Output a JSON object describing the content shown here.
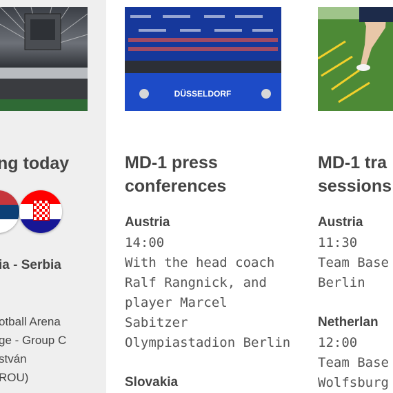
{
  "left_card": {
    "title": "ng today",
    "fixture": "ia - Serbia",
    "venue_lines": [
      "otball Arena",
      "ge - Group C",
      "stván",
      "ROU)"
    ]
  },
  "mid_card": {
    "image_text": "DÜSSELDORF",
    "title_lines": [
      "MD-1 press",
      "conferences"
    ],
    "entries": [
      {
        "country": "Austria",
        "time": "14:00",
        "details": [
          "With the head coach",
          "Ralf Rangnick, and",
          "player Marcel",
          "Sabitzer",
          "Olympiastadion Berlin"
        ]
      },
      {
        "country": "Slovakia"
      }
    ]
  },
  "right_card": {
    "title_lines": [
      "MD-1 tra",
      "sessions"
    ],
    "entries": [
      {
        "country": "Austria",
        "time": "11:30",
        "details": [
          "Team Base",
          "Berlin"
        ]
      },
      {
        "country": "Netherlan",
        "time": "12:00",
        "details": [
          "Team Base",
          "Wolfsburg"
        ]
      }
    ]
  },
  "colors": {
    "left_bg": "#efefef",
    "serbia_red": "#c6363c",
    "croatia_red": "#ff0000",
    "croatia_blue": "#171796"
  }
}
